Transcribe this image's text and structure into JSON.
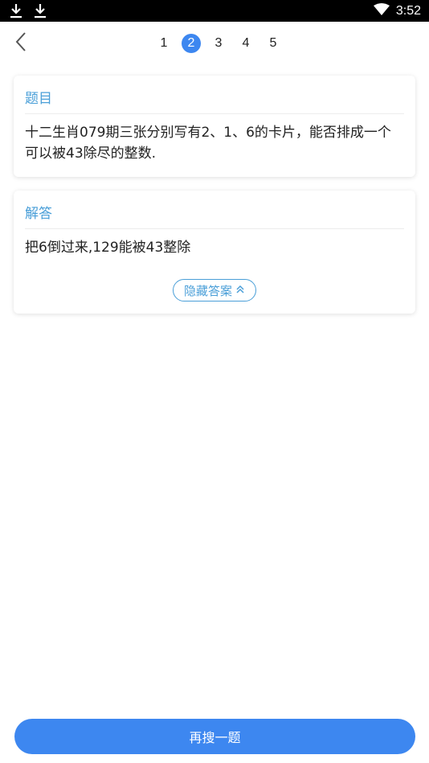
{
  "status_bar": {
    "time": "3:52",
    "icons": [
      "download-icon",
      "download-icon",
      "wifi-icon"
    ]
  },
  "nav": {
    "back_icon": "chevron-left-icon",
    "pages": [
      "1",
      "2",
      "3",
      "4",
      "5"
    ],
    "active_page": "2"
  },
  "question": {
    "title": "题目",
    "text": "十二生肖079期三张分别写有2、1、6的卡片，能否排成一个可以被43除尽的整数."
  },
  "answer": {
    "title": "解答",
    "text": "把6倒过来,129能被43整除",
    "hide_label": "隐藏答案",
    "hide_icon": "double-chevron-up-icon"
  },
  "footer": {
    "search_again_label": "再搜一题"
  },
  "colors": {
    "accent": "#3d87f0",
    "title_blue": "#4a9fd8",
    "status_bar": "#000000"
  }
}
